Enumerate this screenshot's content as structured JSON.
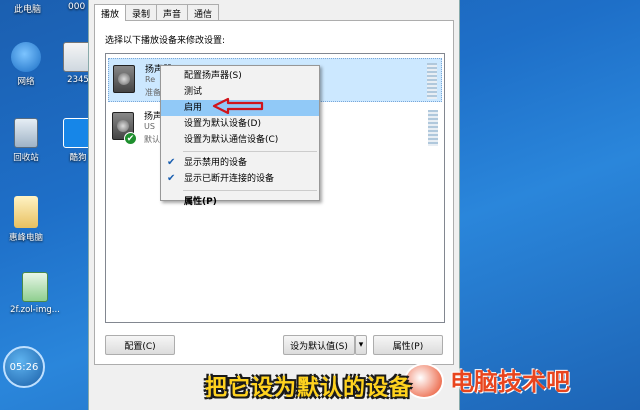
{
  "desktop": {
    "top_labels": [
      "此电脑",
      "000"
    ],
    "icons": [
      {
        "label": "网络"
      },
      {
        "label": "2345"
      },
      {
        "label": "回收站"
      },
      {
        "label": "酷狗"
      },
      {
        "label": "惠峰电脑"
      },
      {
        "label": "2f.zol-img..."
      }
    ],
    "clock": "05:26"
  },
  "dialog": {
    "tabs": [
      "播放",
      "录制",
      "声音",
      "通信"
    ],
    "instruction": "选择以下播放设备来修改设置:",
    "devices": [
      {
        "name": "扬声器",
        "line1": "Re",
        "line2": "准备"
      },
      {
        "name": "扬声",
        "line1": "US",
        "line2": "默认"
      }
    ],
    "buttons": {
      "configure": "配置(C)",
      "set_default": "设为默认值(S)",
      "properties": "属性(P)"
    }
  },
  "context_menu": {
    "items": [
      "配置扬声器(S)",
      "测试",
      "启用",
      "设置为默认设备(D)",
      "设置为默认通信设备(C)"
    ],
    "checked_items": [
      "显示禁用的设备",
      "显示已断开连接的设备"
    ],
    "bold_item": "属性(P)"
  },
  "overlay": {
    "subtitle": "把它设为默认的设备",
    "watermark": "电脑技术吧"
  },
  "colors": {
    "desktop": "#1e6fc8",
    "highlight": "#91c9f7",
    "subtitle": "#ffd21e",
    "watermark": "#e8451e"
  }
}
